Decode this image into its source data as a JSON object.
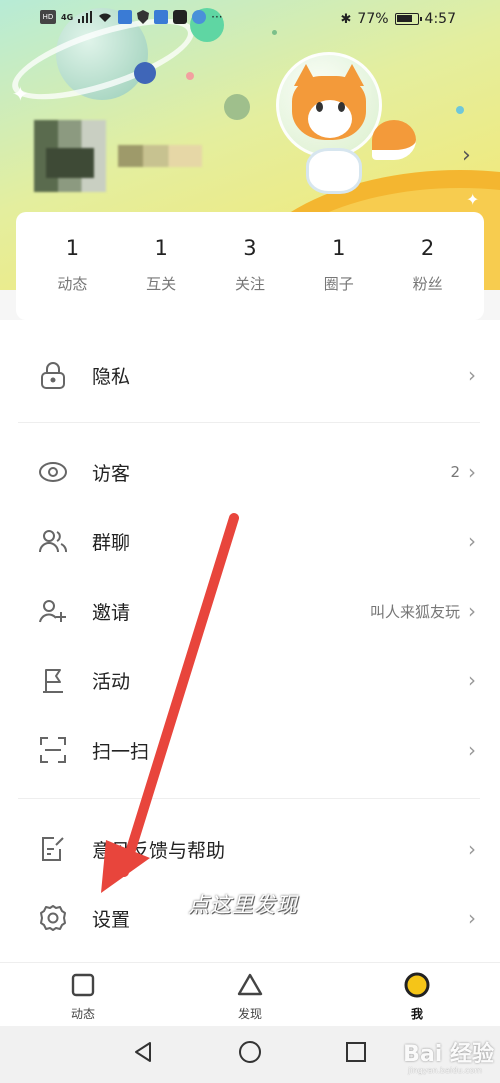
{
  "status_bar": {
    "left_icons": [
      "hd-icon",
      "signal-4g-icon",
      "wifi-icon",
      "cloud-icon",
      "shield-icon",
      "cloud-icon",
      "tiktok-icon",
      "music-icon",
      "more-icon"
    ],
    "hd": "HD",
    "network": "4G",
    "battery_percent": "77%",
    "time": "4:57"
  },
  "stats": [
    {
      "count": "1",
      "label": "动态"
    },
    {
      "count": "1",
      "label": "互关"
    },
    {
      "count": "3",
      "label": "关注"
    },
    {
      "count": "1",
      "label": "圈子"
    },
    {
      "count": "2",
      "label": "粉丝"
    }
  ],
  "menu": {
    "privacy": {
      "label": "隐私",
      "icon": "lock-icon"
    },
    "visitors": {
      "label": "访客",
      "value": "2",
      "icon": "eye-icon"
    },
    "group_chat": {
      "label": "群聊",
      "icon": "group-icon"
    },
    "invite": {
      "label": "邀请",
      "value": "叫人来狐友玩",
      "icon": "add-user-icon"
    },
    "activity": {
      "label": "活动",
      "icon": "flag-icon"
    },
    "scan": {
      "label": "扫一扫",
      "icon": "scan-icon"
    },
    "feedback": {
      "label": "意见反馈与帮助",
      "icon": "feedback-icon"
    },
    "settings": {
      "label": "设置",
      "icon": "gear-icon"
    }
  },
  "tabs": [
    {
      "label": "动态",
      "icon": "square-icon"
    },
    {
      "label": "发现",
      "icon": "triangle-icon"
    },
    {
      "label": "我",
      "icon": "circle-icon",
      "active": true
    }
  ],
  "annotation": {
    "text": "点这里发现",
    "arrow_color": "#e8453c"
  },
  "watermark": {
    "main": "Bai 经验",
    "sub": "jingyan.baidu.com"
  },
  "colors": {
    "accent_yellow": "#f5c518",
    "arrow_red": "#e8453c"
  }
}
